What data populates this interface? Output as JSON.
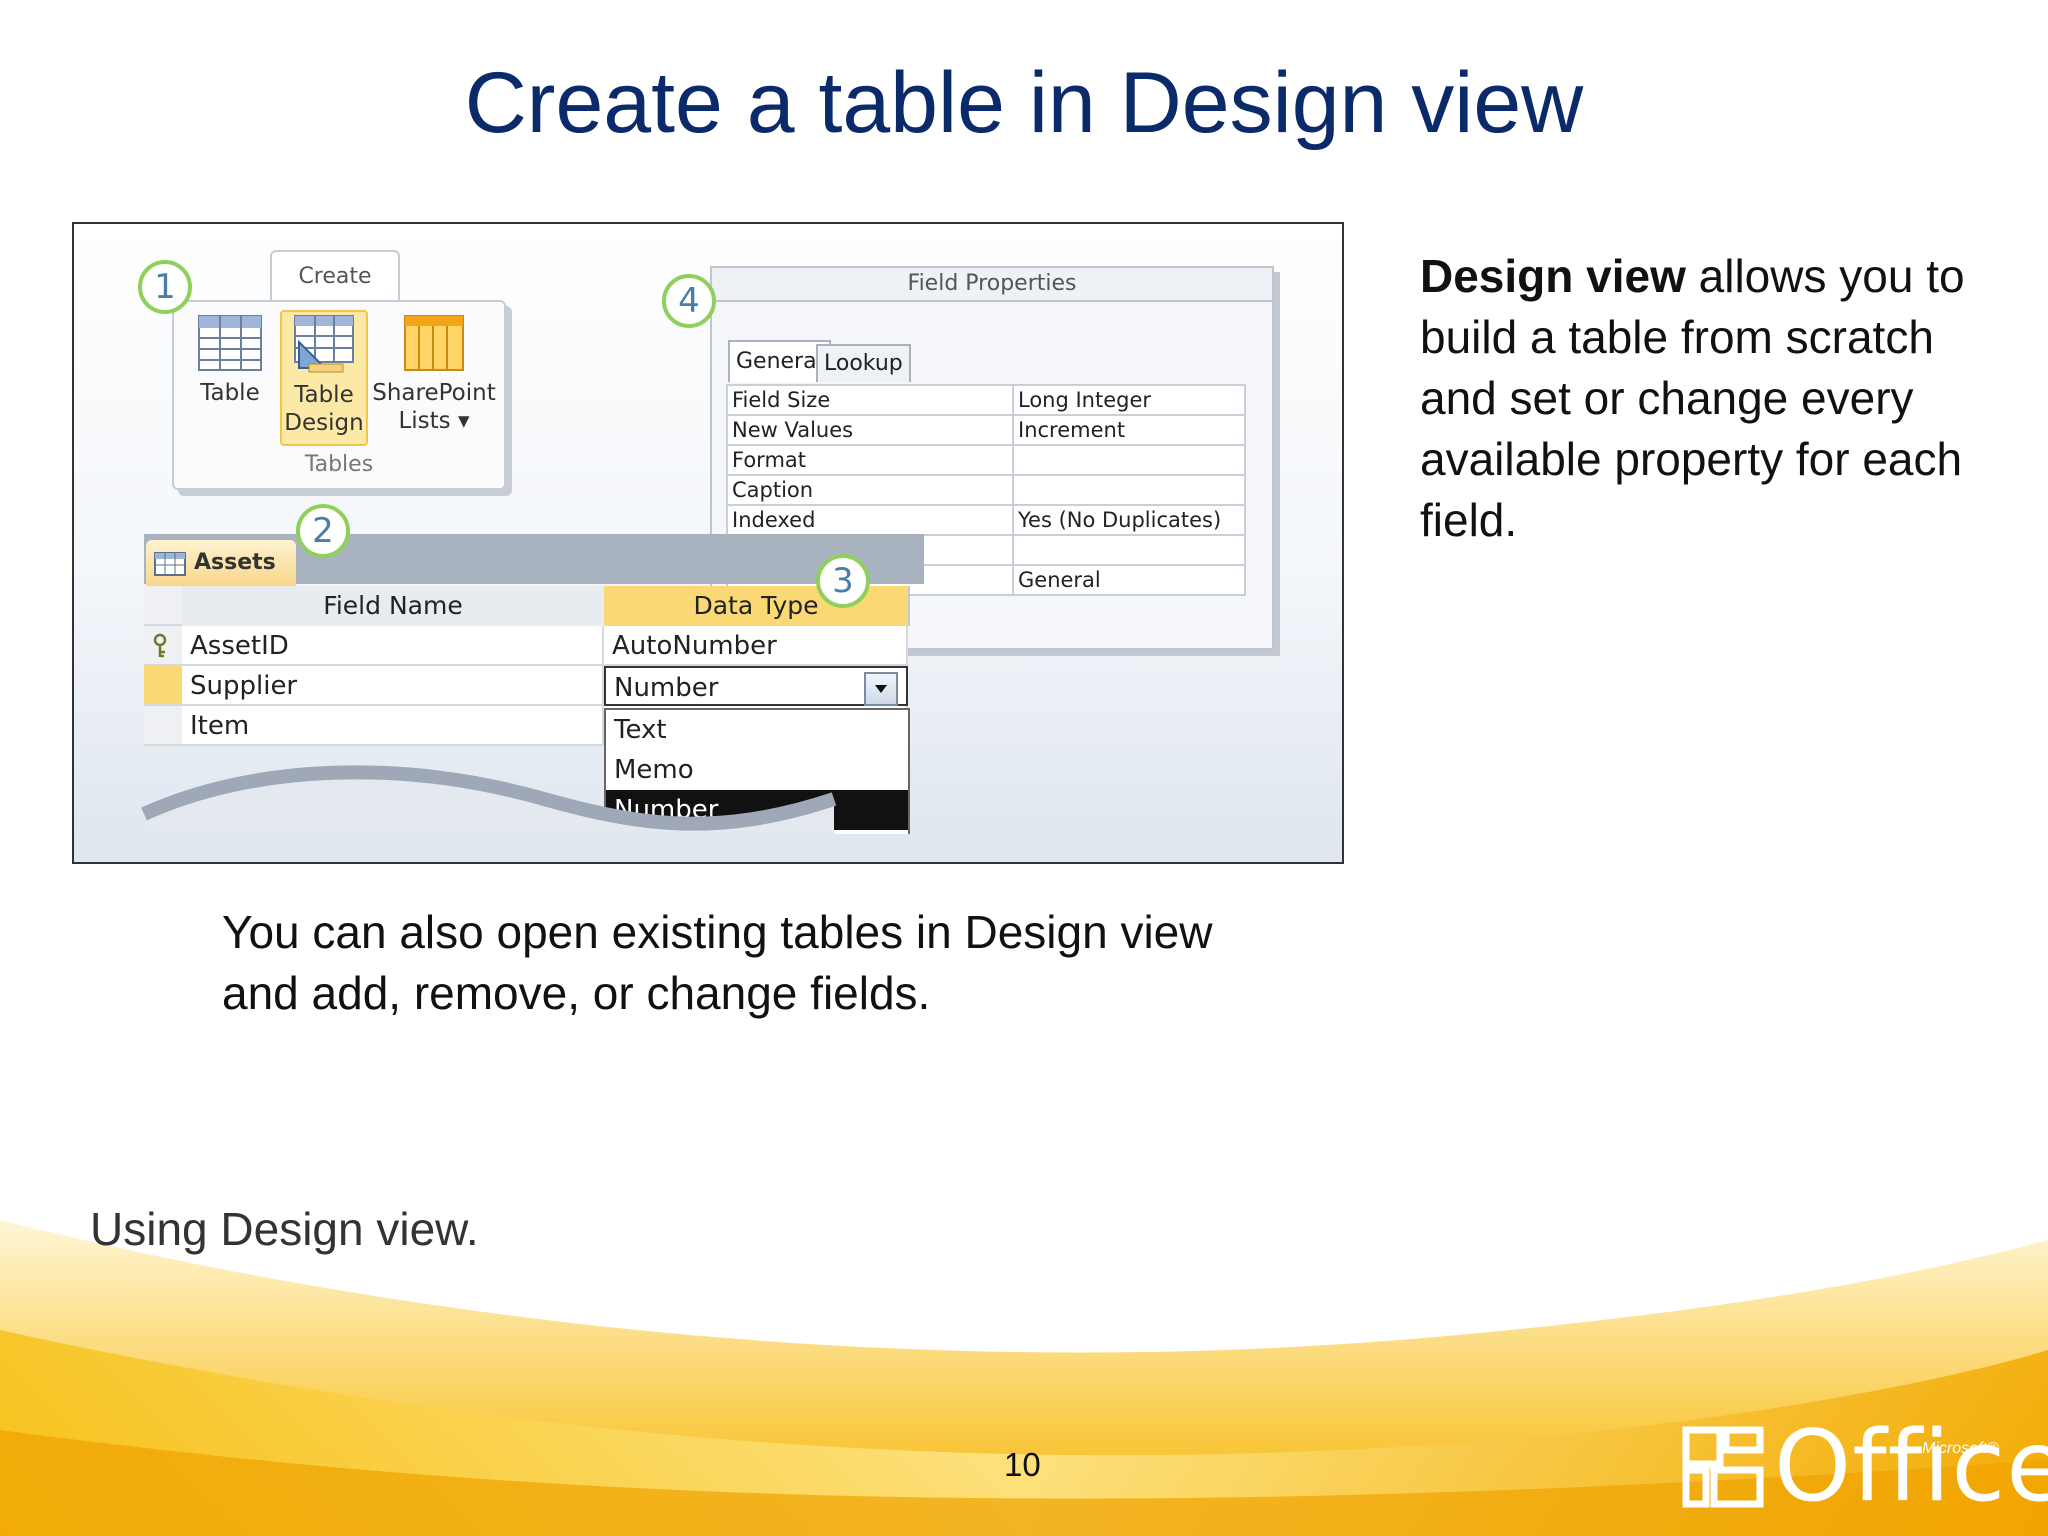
{
  "slide": {
    "title": "Create a table in Design view",
    "description_bold": "Design view",
    "description_rest": " allows you to build a table from scratch and set or change every available property for each field.",
    "note_line1": "You can also open existing tables in Design view",
    "note_line2": "and add, remove, or change fields.",
    "caption": "Using Design view.",
    "page_number": "10"
  },
  "screenshot": {
    "callouts": [
      "1",
      "2",
      "3",
      "4"
    ],
    "ribbon": {
      "tab_label": "Create",
      "buttons": [
        {
          "line1": "Table",
          "line2": ""
        },
        {
          "line1": "Table",
          "line2": "Design"
        },
        {
          "line1": "SharePoint",
          "line2": "Lists ▾"
        }
      ],
      "group_label": "Tables"
    },
    "field_properties": {
      "title": "Field Properties",
      "tabs": [
        "General",
        "Lookup"
      ],
      "rows": [
        [
          "Field Size",
          "Long Integer"
        ],
        [
          "New Values",
          "Increment"
        ],
        [
          "Format",
          ""
        ],
        [
          "Caption",
          ""
        ],
        [
          "Indexed",
          "Yes (No Duplicates)"
        ],
        [
          "",
          ""
        ],
        [
          "",
          "General"
        ]
      ]
    },
    "designer": {
      "tab_label": "Assets",
      "columns": [
        "Field Name",
        "Data Type"
      ],
      "rows": [
        [
          "AssetID",
          "AutoNumber"
        ],
        [
          "Supplier",
          "Number"
        ],
        [
          "Item",
          ""
        ]
      ],
      "dropdown_options": [
        "Text",
        "Memo",
        "Number"
      ]
    }
  },
  "branding": {
    "logo_text": "Office",
    "logo_superscript": "Microsoft®",
    "accent_color": "#f5b400"
  }
}
